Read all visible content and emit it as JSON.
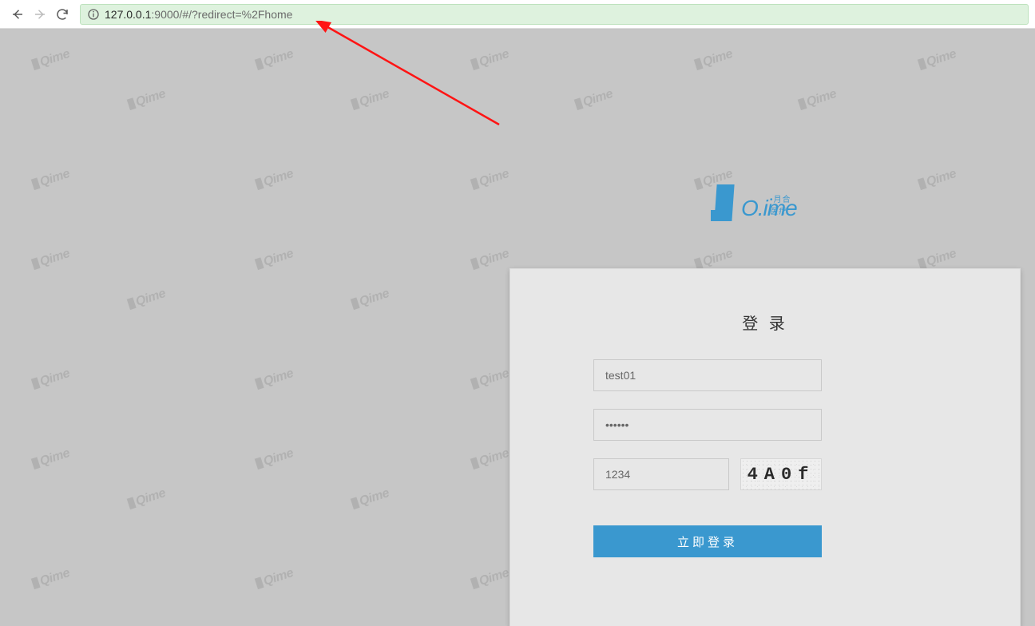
{
  "browser": {
    "url_host": "127.0.0.1",
    "url_rest": ":9000/#/?redirect=%2Fhome"
  },
  "brand": {
    "text": "O.ime",
    "sub": "•月合医疗"
  },
  "login": {
    "title": "登 录",
    "username_value": "test01",
    "password_value": "••••••",
    "captcha_value": "1234",
    "captcha_image_text": "4A0f",
    "submit_label": "立即登录"
  },
  "watermark_text": "Qime"
}
